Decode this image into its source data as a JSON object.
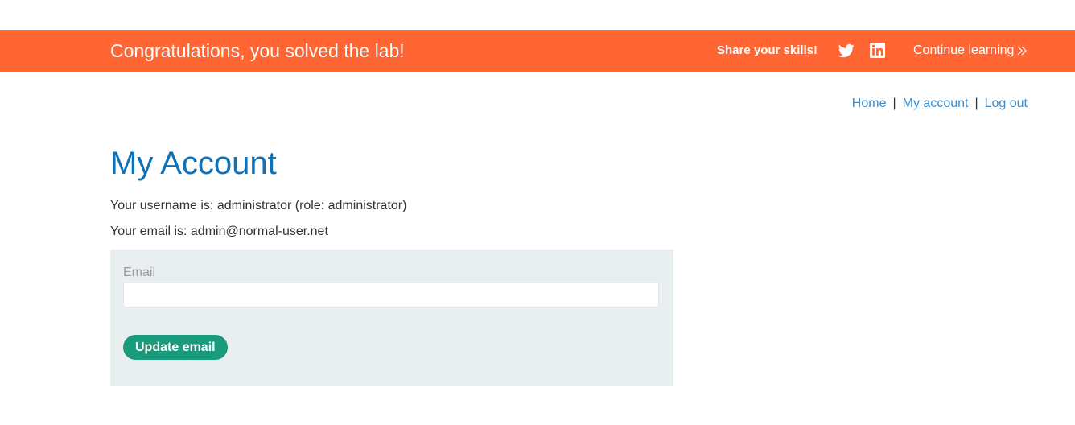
{
  "banner": {
    "title": "Congratulations, you solved the lab!",
    "share_label": "Share your skills!",
    "twitter_icon": "twitter-icon",
    "linkedin_icon": "linkedin-icon",
    "continue_label": "Continue learning",
    "continue_icon": "double-chevron-right-icon",
    "background_color": "#ff6633"
  },
  "nav": {
    "home": "Home",
    "separator": "|",
    "my_account": "My account",
    "log_out": "Log out",
    "link_color": "#3a8dcf"
  },
  "page": {
    "title": "My Account",
    "title_color": "#0e72b8",
    "username_line": "Your username is: administrator (role: administrator)",
    "email_line": "Your email is: admin@normal-user.net"
  },
  "form": {
    "email_label": "Email",
    "email_value": "",
    "submit_label": "Update email",
    "panel_color": "#e9eef1",
    "button_color": "#1a9c7c"
  }
}
